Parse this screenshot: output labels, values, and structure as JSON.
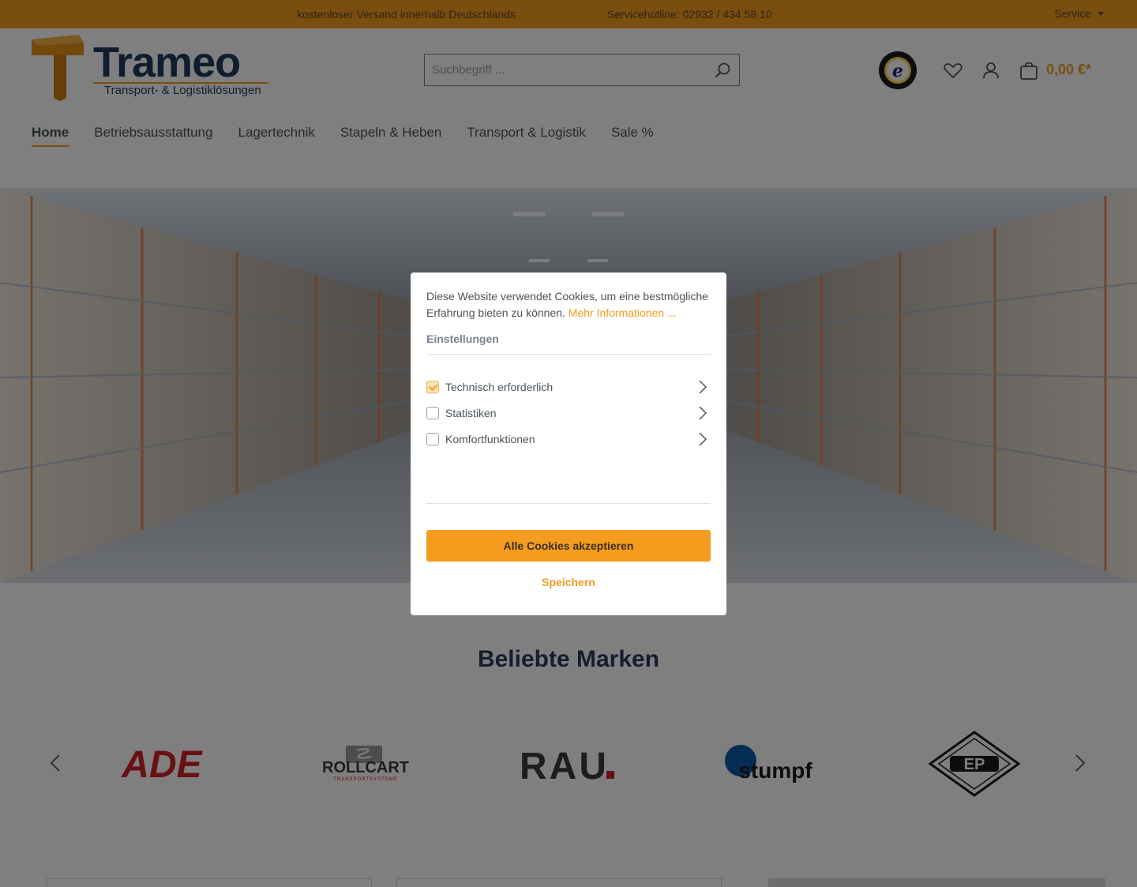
{
  "topbar": {
    "shipping_text": "kostenloser Versand innerhalb Deutschlands",
    "hotline_text": "Servicehotline: 02932 / 434 58 10",
    "service_label": "Service"
  },
  "header": {
    "logo_name": "Trameo",
    "logo_tagline": "Transport- & Logistiklösungen",
    "search_placeholder": "Suchbegriff ...",
    "cart_total": "0,00 €*",
    "trust_badge_text": "TRUSTED SHOPS GUARANTEE"
  },
  "nav": {
    "items": [
      {
        "label": "Home"
      },
      {
        "label": "Betriebsausstattung"
      },
      {
        "label": "Lagertechnik"
      },
      {
        "label": "Stapeln & Heben"
      },
      {
        "label": "Transport & Logistik"
      },
      {
        "label": "Sale %"
      }
    ]
  },
  "brands": {
    "title": "Beliebte Marken",
    "items": [
      {
        "name": "ADE"
      },
      {
        "name": "ROLLCART",
        "tagline": "TRANSPORTSYSTEME"
      },
      {
        "name": "RAU."
      },
      {
        "name": "stumpf"
      },
      {
        "name": "EP"
      }
    ]
  },
  "cookie_modal": {
    "text": "Diese Website verwendet Cookies, um eine bestmögliche Erfahrung bieten zu können.",
    "more_link": "Mehr Informationen ...",
    "settings_heading": "Einstellungen",
    "options": [
      {
        "label": "Technisch erforderlich",
        "checked": true
      },
      {
        "label": "Statistiken",
        "checked": false
      },
      {
        "label": "Komfortfunktionen",
        "checked": false
      }
    ],
    "accept_label": "Alle Cookies akzeptieren",
    "save_label": "Speichern"
  },
  "colors": {
    "accent": "#f39c1e",
    "brand_navy": "#1e3a5c",
    "text": "#4a545b"
  }
}
